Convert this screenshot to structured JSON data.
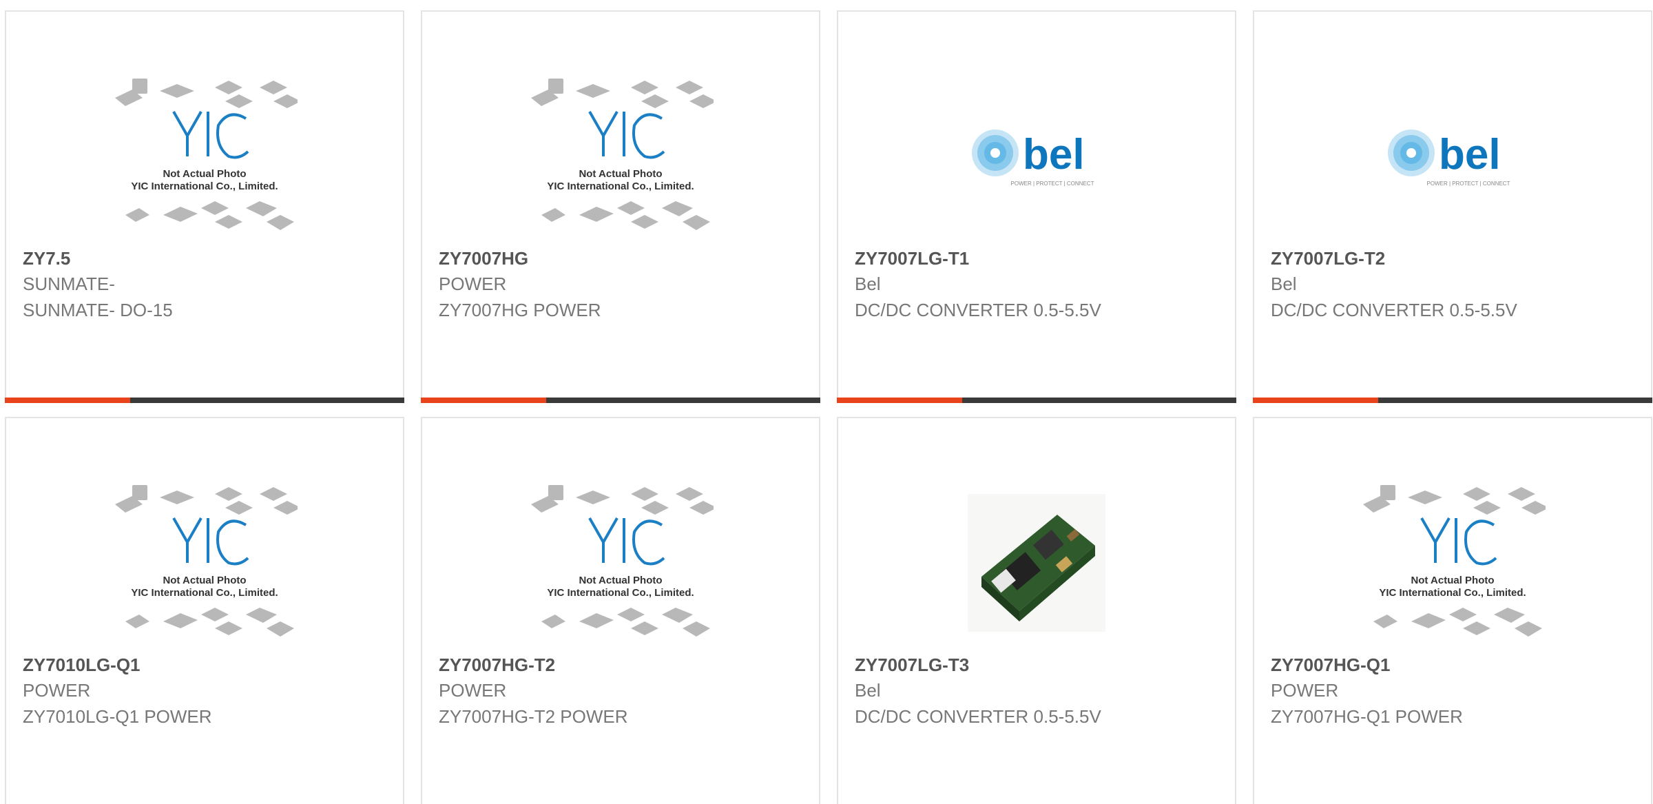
{
  "products": [
    {
      "name": "ZY7.5",
      "manufacturer": "SUNMATE-",
      "description": "SUNMATE- DO-15",
      "image": "yic-placeholder",
      "placeholder_text": [
        "Not Actual Photo",
        "YIC International Co., Limited."
      ]
    },
    {
      "name": "ZY7007HG",
      "manufacturer": "POWER",
      "description": "ZY7007HG POWER",
      "image": "yic-placeholder",
      "placeholder_text": [
        "Not Actual Photo",
        "YIC International Co., Limited."
      ]
    },
    {
      "name": "ZY7007LG-T1",
      "manufacturer": "Bel",
      "description": "DC/DC CONVERTER 0.5-5.5V",
      "image": "bel-logo",
      "logo_text": "bel",
      "logo_tagline": "POWER | PROTECT | CONNECT"
    },
    {
      "name": "ZY7007LG-T2",
      "manufacturer": "Bel",
      "description": "DC/DC CONVERTER 0.5-5.5V",
      "image": "bel-logo",
      "logo_text": "bel",
      "logo_tagline": "POWER | PROTECT | CONNECT"
    },
    {
      "name": "ZY7010LG-Q1",
      "manufacturer": "POWER",
      "description": "ZY7010LG-Q1 POWER",
      "image": "yic-placeholder",
      "placeholder_text": [
        "Not Actual Photo",
        "YIC International Co., Limited."
      ]
    },
    {
      "name": "ZY7007HG-T2",
      "manufacturer": "POWER",
      "description": "ZY7007HG-T2 POWER",
      "image": "yic-placeholder",
      "placeholder_text": [
        "Not Actual Photo",
        "YIC International Co., Limited."
      ]
    },
    {
      "name": "ZY7007LG-T3",
      "manufacturer": "Bel",
      "description": "DC/DC CONVERTER 0.5-5.5V",
      "image": "module-photo"
    },
    {
      "name": "ZY7007HG-Q1",
      "manufacturer": "POWER",
      "description": "ZY7007HG-Q1 POWER",
      "image": "yic-placeholder",
      "placeholder_text": [
        "Not Actual Photo",
        "YIC International Co., Limited."
      ]
    }
  ],
  "colors": {
    "accent": "#e8431a",
    "bar": "#3a3a3a",
    "yic_blue": "#1a7fc4",
    "bel_blue": "#0e76bc",
    "bel_light": "#5ab4e5"
  }
}
